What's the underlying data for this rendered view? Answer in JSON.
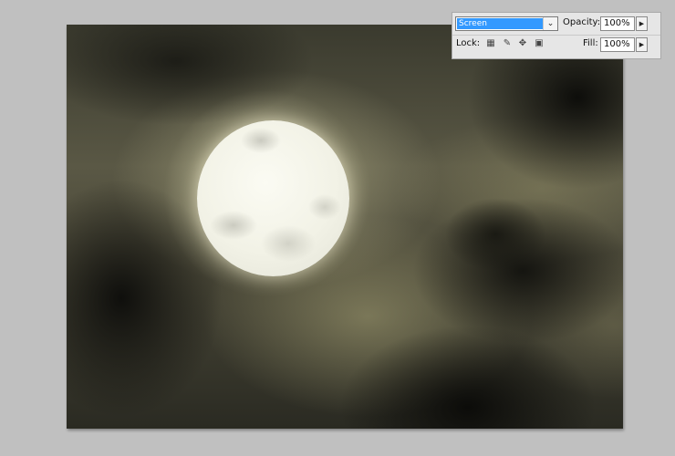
{
  "layers_panel": {
    "blend_mode": "Screen",
    "opacity_label": "Opacity:",
    "opacity_value": "100%",
    "lock_label": "Lock:",
    "fill_label": "Fill:",
    "fill_value": "100%",
    "lock_icons": [
      "lock-transparent-pixels-icon",
      "lock-image-pixels-icon",
      "lock-position-icon",
      "lock-all-icon"
    ]
  },
  "canvas": {
    "content": "moon",
    "colors": {
      "sky": "#4a4838",
      "moon": "#f2f2e6"
    }
  },
  "colors": {
    "selection": "#3399ff",
    "workspace": "#c0c0c0",
    "panel": "#e6e6e6"
  }
}
